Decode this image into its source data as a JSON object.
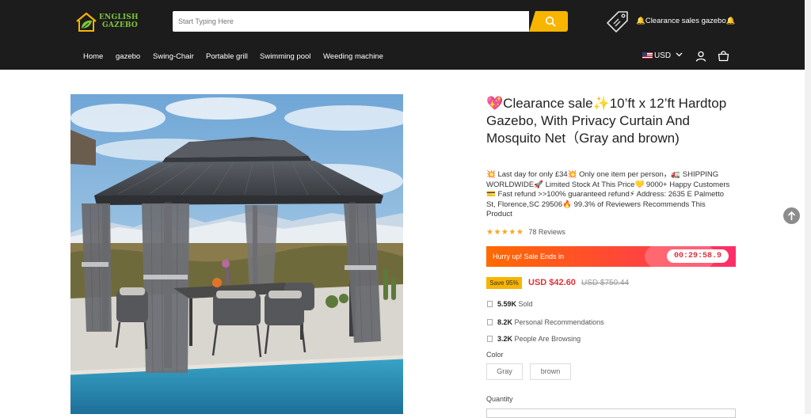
{
  "header": {
    "logo_line1": "ENGLISH",
    "logo_line2": "GAZEBO",
    "search_placeholder": "Start Typing Here",
    "clearance_link": "🔔Clearance sales gazebo🔔",
    "currency": "USD"
  },
  "nav": {
    "items": [
      "Home",
      "gazebo",
      "Swing-Chair",
      "Portable grill",
      "Swimming pool",
      "Weeding machine"
    ]
  },
  "product": {
    "title": "💖Clearance sale✨10’ft x 12’ft Hardtop Gazebo, With Privacy Curtain And Mosquito Net（Gray and brown)",
    "description": "💥 Last day for only £34💥 Only one item per person，🚛 SHIPPING WORLDWIDE🚀 Limited Stock At This Price💛 9000+ Happy Customers💳 Fast refund >>100% guaranteed refund⚡ Address: 2635 E Palmetto St, Florence,SC 29506🔥 99.3% of Reviewers Recommends This Product",
    "stars": "★★★★★",
    "rating": 5,
    "reviews": "78 Reviews",
    "sale_banner": "Hurry up! Sale Ends in",
    "countdown": "00:29:58.9",
    "save_badge": "Save 95%",
    "price": "USD $42.60",
    "old_price": "USD $750.44",
    "stats": [
      {
        "value": "5.59K",
        "label": "Sold"
      },
      {
        "value": "8.2K",
        "label": "Personal Recommendations"
      },
      {
        "value": "3.2K",
        "label": "People Are Browsing"
      }
    ],
    "color_label": "Color",
    "color_options": [
      "Gray",
      "brown"
    ],
    "quantity_label": "Quantity"
  },
  "colors": {
    "header_bg": "#1c1c1c",
    "accent_yellow": "#f7b500",
    "price_red": "#e0313b",
    "logo_green": "#7ec63a"
  }
}
